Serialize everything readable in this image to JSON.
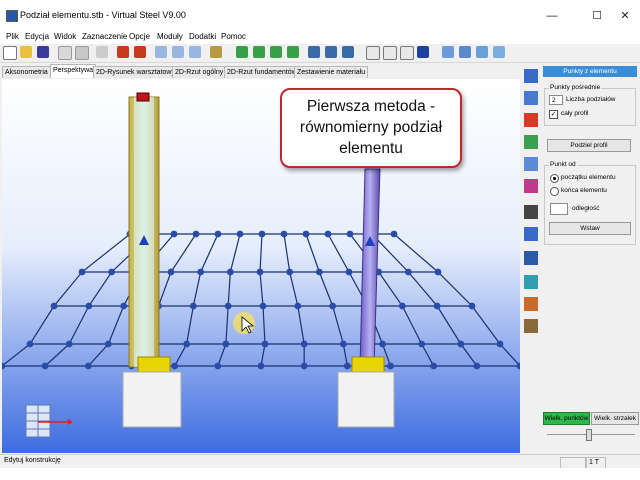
{
  "window": {
    "title": "Podział elementu.stb  - Virtual Steel V9.00",
    "minimize": "—",
    "maximize": "☐",
    "close": "✕"
  },
  "menu": [
    "Plik",
    "Edycja",
    "Widok",
    "Zaznaczenie",
    "Opcje",
    "Moduły",
    "Dodatki",
    "Pomoc"
  ],
  "tabs": [
    "Aksonometria",
    "Perspektywa",
    "2D-Rysunek warsztatowy",
    "2D-Rzut ogólny",
    "2D-Rzut fundamentów",
    "Zestawienie materiału"
  ],
  "active_tab": "Perspektywa",
  "callout": {
    "line1": "Pierwsza metoda -",
    "line2": "równomierny podział",
    "line3": "elementu"
  },
  "panel": {
    "header": "Punkty z elementu",
    "group1_title": "Punkty pośrednie",
    "divisions_value": "2",
    "divisions_label": "Liczba podziałów",
    "whole_profile_checked": "✓",
    "whole_profile_label": "cały profil",
    "split_button": "Podziel profil",
    "group2_title": "Punkt od",
    "opt_start": "początku elementu",
    "opt_end": "końca elementu",
    "distance_value": "",
    "distance_label": "odległość",
    "insert_button": "Wstaw",
    "point_size_button": "Wielk. punktów",
    "arrow_size_button": "Wielk. strzałek"
  },
  "status": {
    "text": "Edytuj konstrukcję",
    "cell2": "1 T"
  },
  "colors": {
    "grid": "#1c2f6e",
    "node": "#2b4ba8",
    "panel_header": "#3a8ed8",
    "callout_border": "#c0292b",
    "green_button": "#2fb84a"
  }
}
